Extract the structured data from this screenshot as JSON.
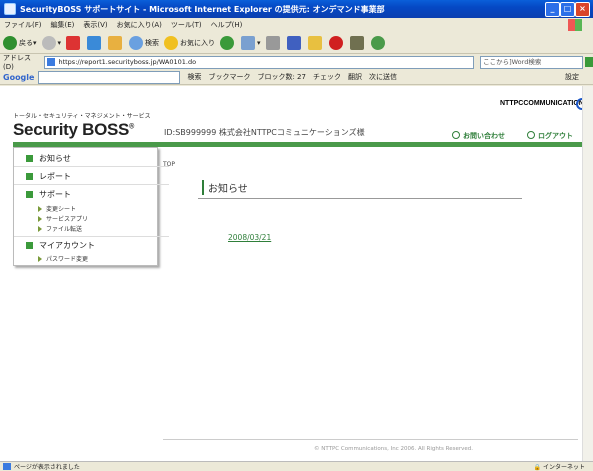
{
  "window": {
    "title": "SecurityBOSS サポートサイト - Microsoft Internet Explorer の提供元: オンデマンド事業部"
  },
  "menu": [
    "ファイル(F)",
    "編集(E)",
    "表示(V)",
    "お気に入り(A)",
    "ツール(T)",
    "ヘルプ(H)"
  ],
  "toolbar": {
    "back": "戻る",
    "search": "検索",
    "favorites": "お気に入り"
  },
  "address": {
    "label": "アドレス(D)",
    "url": "https://report1.securityboss.jp/WA0101.do",
    "search_hint": "ここから]Word検索"
  },
  "googlebar": {
    "logo": "Google",
    "search_label": "検索",
    "bookmarks": "ブックマーク",
    "blocked": "ブロック数: 27",
    "check": "チェック",
    "translate": "翻訳",
    "send": "次に送信",
    "settings": "設定"
  },
  "header": {
    "brand_sub": "トータル・セキュリティ・マネジメント・サービス",
    "brand": "Security BOSS",
    "brand_mark": "®",
    "account": "ID:SB999999 株式会社NTTPCコミュニケーションズ様",
    "company_logo": "NTTPCCOMMUNICATIONS",
    "contact": "お問い合わせ",
    "logout": "ログアウト"
  },
  "sidebar": {
    "items": [
      {
        "label": "お知らせ"
      },
      {
        "label": "レポート"
      },
      {
        "label": "サポート",
        "children": [
          "変更シート",
          "サービスアプリ",
          "ファイル転送"
        ]
      },
      {
        "label": "マイアカウント",
        "children": [
          "パスワード変更"
        ]
      }
    ]
  },
  "main": {
    "breadcrumb": "TOP",
    "heading": "お知らせ",
    "news": [
      "2008/03/21"
    ]
  },
  "footer": {
    "copyright": "© NTTPC Communications, Inc 2006. All Rights Reserved."
  },
  "status": {
    "text": "ページが表示されました",
    "zone": "インターネット"
  }
}
